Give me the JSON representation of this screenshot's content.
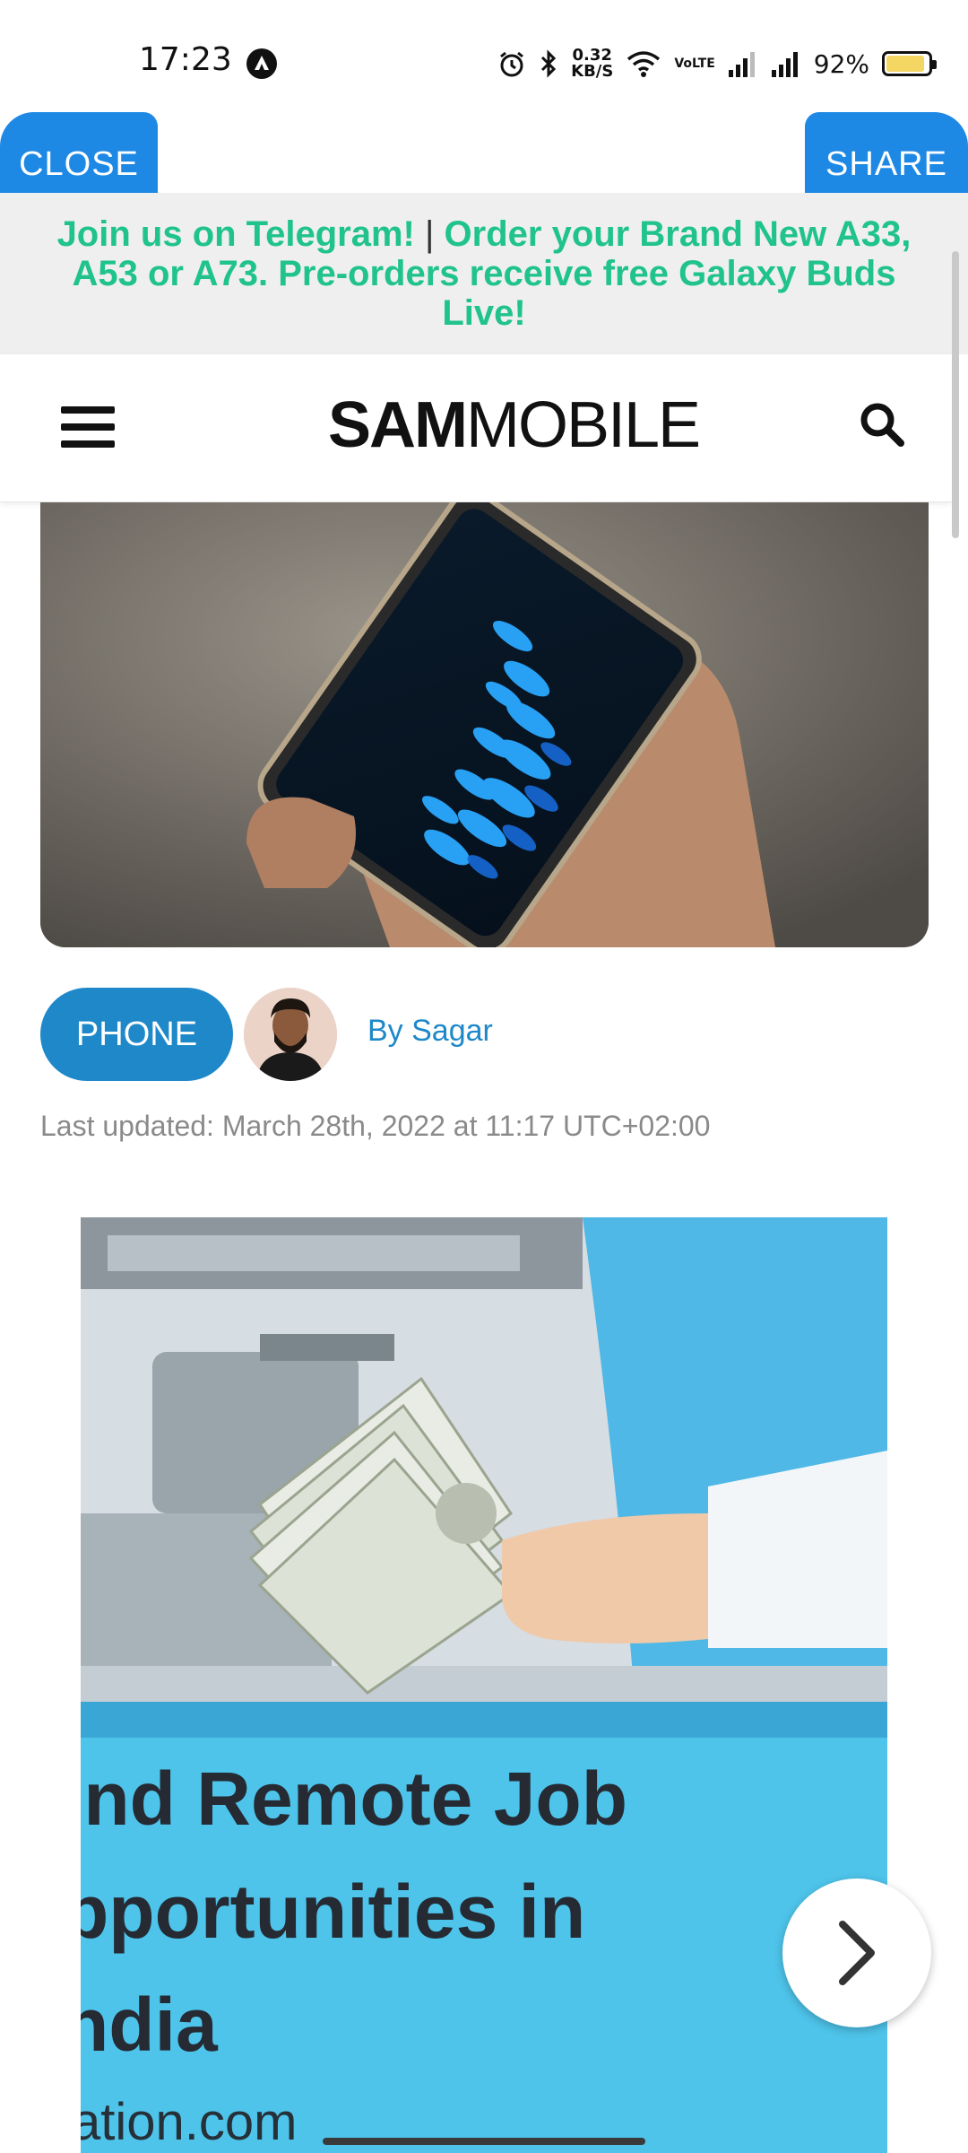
{
  "status_bar": {
    "time": "17:23",
    "net_speed_value": "0.32",
    "net_speed_unit": "KB/S",
    "network_label": "VoLTE",
    "battery_percent": "92%",
    "battery_level": 0.92
  },
  "top_buttons": {
    "close_label": "CLOSE",
    "share_label": "SHARE"
  },
  "promo": {
    "telegram_text": "Join us on Telegram!",
    "separator": "|",
    "order_text": "Order your Brand New A33, A53 or A73. Pre-orders receive free Galaxy Buds Live!"
  },
  "header": {
    "logo_sam": "SAM",
    "logo_mobile": "MOBILE",
    "menu_icon": "hamburger-icon",
    "search_icon": "search-icon"
  },
  "article_meta": {
    "category": "PHONE",
    "byline": "By Sagar",
    "last_updated": "Last updated: March 28th, 2022 at 11:17 UTC+02:00"
  },
  "ad": {
    "headline_line1": "ind Remote Job",
    "headline_line2": "pportunities in",
    "headline_line3": "ndia",
    "domain": "ation.com",
    "next_icon": "chevron-right-icon"
  },
  "colors": {
    "accent_blue": "#1e88e5",
    "promo_green": "#20c38c",
    "tag_blue": "#1e88c9",
    "ad_background": "#4ec4ea"
  }
}
